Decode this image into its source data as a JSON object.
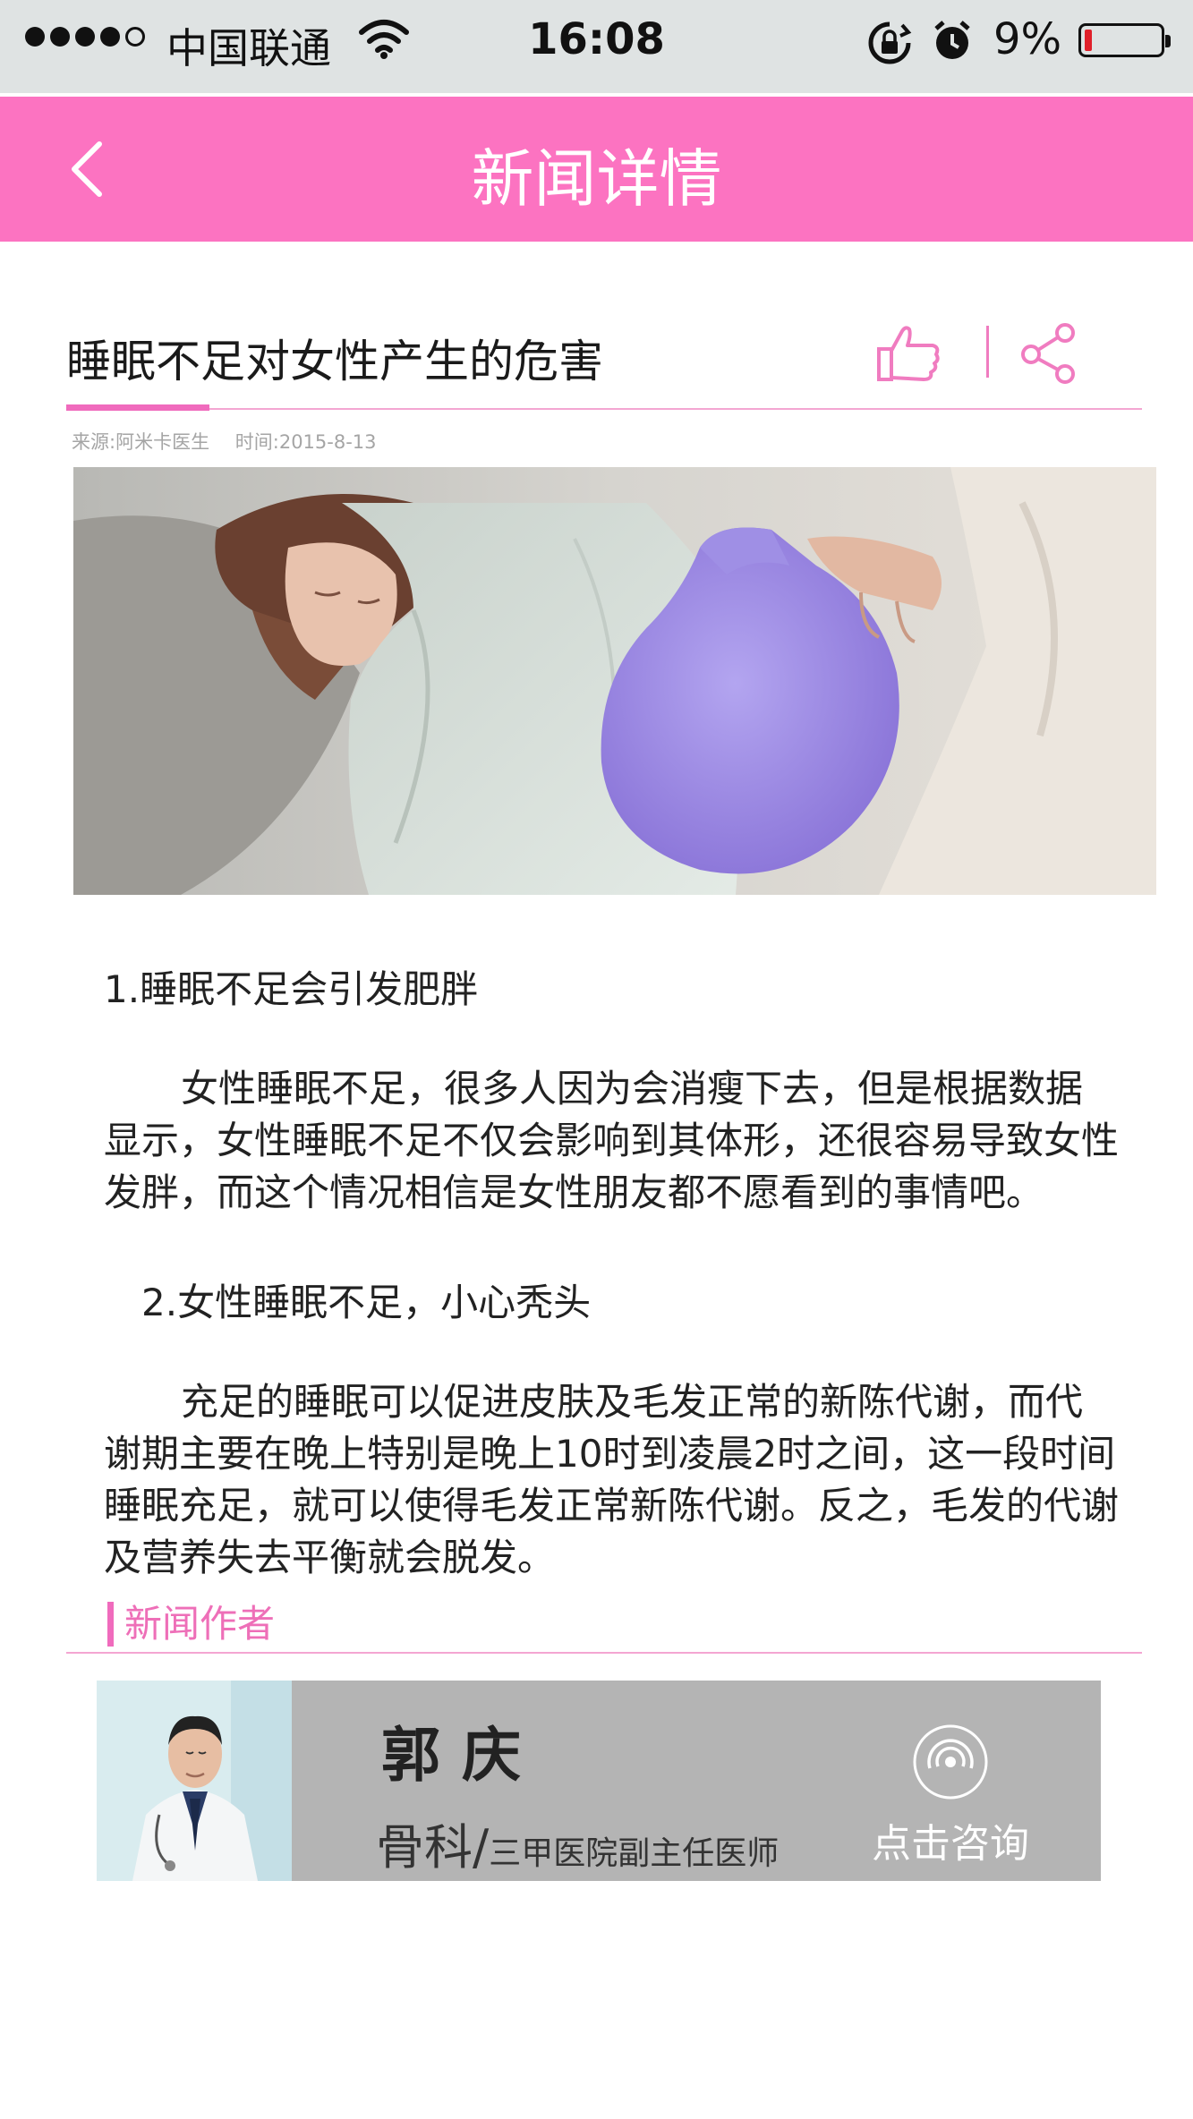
{
  "status_bar": {
    "carrier": "中国联通",
    "time": "16:08",
    "battery": "9%",
    "battery_level": 0.09
  },
  "nav": {
    "title": "新闻详情"
  },
  "article": {
    "title": "睡眠不足对女性产生的危害",
    "source": "来源:阿米卡医生",
    "date": "时间:2015-8-13",
    "sections": [
      {
        "heading": "1.睡眠不足会引发肥胖",
        "body": "女性睡眠不足，很多人因为会消瘦下去，但是根据数据显示，女性睡眠不足不仅会影响到其体形，还很容易导致女性发胖，而这个情况相信是女性朋友都不愿看到的事情吧。"
      },
      {
        "heading": "2.女性睡眠不足，小心秃头",
        "body": "充足的睡眠可以促进皮肤及毛发正常的新陈代谢，而代谢期主要在晚上特别是晚上10时到凌晨2时之间，这一段时间睡眠充足，就可以使得毛发正常新陈代谢。反之，毛发的代谢及营养失去平衡就会脱发。"
      }
    ]
  },
  "author": {
    "section_label": "新闻作者",
    "name": "郭庆",
    "department": "骨科",
    "separator": "/",
    "position": "三甲医院副主任医师",
    "consult_label": "点击咨询"
  },
  "colors": {
    "accent": "#fc73c1",
    "card": "#b4b4b4"
  }
}
